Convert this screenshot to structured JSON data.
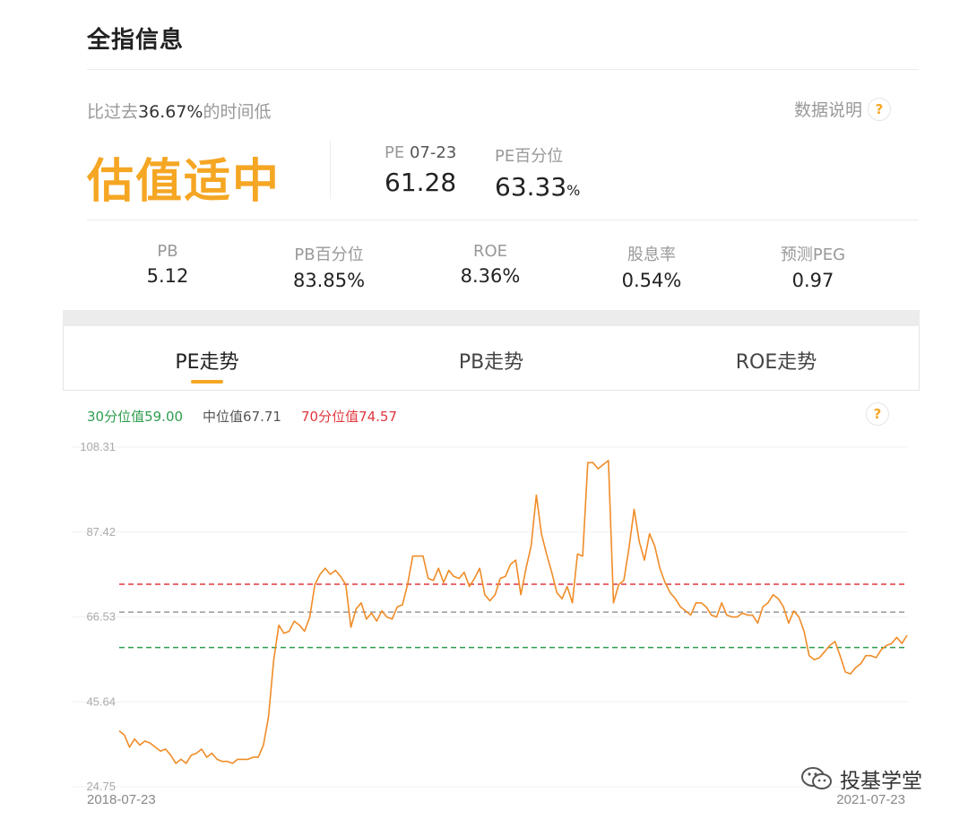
{
  "header": {
    "title": "全指信息"
  },
  "summary": {
    "compare_prefix": "比过去",
    "compare_value": "36.67%",
    "compare_suffix": "的时间低",
    "data_note": "数据说明",
    "help": "?",
    "valuation": "估值适中"
  },
  "pe": {
    "label": "PE",
    "date": "07-23",
    "value": "61.28",
    "pct_label": "PE百分位",
    "pct_value": "63.33",
    "pct_unit": "%"
  },
  "metrics": [
    {
      "label": "PB",
      "value": "5.12"
    },
    {
      "label": "PB百分位",
      "value": "83.85%"
    },
    {
      "label": "ROE",
      "value": "8.36%"
    },
    {
      "label": "股息率",
      "value": "0.54%"
    },
    {
      "label": "预测PEG",
      "value": "0.97"
    }
  ],
  "tabs": [
    {
      "label": "PE走势",
      "active": true
    },
    {
      "label": "PB走势",
      "active": false
    },
    {
      "label": "ROE走势",
      "active": false
    }
  ],
  "legend": {
    "p30": "30分位值59.00",
    "median": "中位值67.71",
    "p70": "70分位值74.57"
  },
  "watermark": {
    "text": "投基学堂",
    "icon": "wechat-icon"
  },
  "colors": {
    "accent": "#f5a623",
    "line": "#f08c28",
    "green": "#2e9d4f",
    "red": "#e0383e",
    "gray": "#999999"
  },
  "chart_data": {
    "type": "line",
    "x_start": "2018-07-23",
    "x_end": "2021-07-23",
    "yticks": [
      108.31,
      87.42,
      66.53,
      45.64,
      24.75
    ],
    "ylim": [
      24.75,
      108.31
    ],
    "grid": true,
    "reference_lines": [
      {
        "label": "70分位值",
        "value": 74.57,
        "color": "#e0383e"
      },
      {
        "label": "中位值",
        "value": 67.71,
        "color": "#999999"
      },
      {
        "label": "30分位值",
        "value": 59.0,
        "color": "#2e9d4f"
      }
    ],
    "series": [
      {
        "values": [
          38.5,
          37.5,
          34.5,
          36.5,
          35.0,
          36.0,
          35.5,
          34.5,
          33.5,
          34.0,
          32.5,
          30.5,
          31.5,
          30.5,
          32.5,
          33.0,
          34.0,
          32.0,
          33.0,
          31.5,
          31.0,
          31.0,
          30.5,
          31.5,
          31.5,
          31.5,
          32.0,
          32.0,
          35.0,
          42.0,
          56.0,
          64.5,
          62.5,
          63.0,
          65.5,
          64.5,
          63.0,
          66.5,
          74.5,
          77.0,
          78.5,
          77.0,
          78.0,
          76.5,
          74.5,
          64.0,
          68.5,
          70.0,
          66.0,
          67.5,
          65.5,
          68.0,
          66.5,
          66.0,
          69.0,
          69.5,
          74.5,
          81.5,
          81.5,
          81.5,
          76.0,
          75.5,
          78.5,
          75.0,
          78.0,
          76.5,
          76.0,
          77.5,
          74.0,
          76.0,
          78.5,
          72.0,
          70.5,
          72.0,
          76.0,
          76.5,
          79.5,
          80.5,
          72.0,
          78.5,
          84.0,
          96.5,
          87.0,
          82.0,
          77.5,
          72.5,
          71.0,
          74.0,
          70.0,
          82.0,
          81.5,
          104.5,
          104.5,
          103.0,
          104.0,
          105.0,
          70.0,
          74.5,
          75.5,
          83.5,
          93.0,
          85.0,
          80.5,
          87.0,
          84.0,
          78.5,
          75.0,
          72.5,
          71.0,
          69.0,
          68.0,
          67.0,
          70.0,
          70.0,
          69.0,
          67.0,
          66.5,
          70.0,
          67.0,
          66.5,
          66.5,
          67.5,
          67.0,
          67.0,
          65.0,
          69.0,
          70.0,
          72.0,
          71.0,
          69.0,
          65.0,
          68.0,
          66.5,
          63.0,
          57.0,
          56.0,
          56.5,
          58.0,
          59.5,
          60.5,
          57.0,
          53.0,
          52.5,
          54.0,
          55.0,
          57.0,
          57.0,
          56.5,
          58.5,
          59.5,
          60.0,
          61.5,
          60.0,
          62.0
        ]
      }
    ]
  }
}
